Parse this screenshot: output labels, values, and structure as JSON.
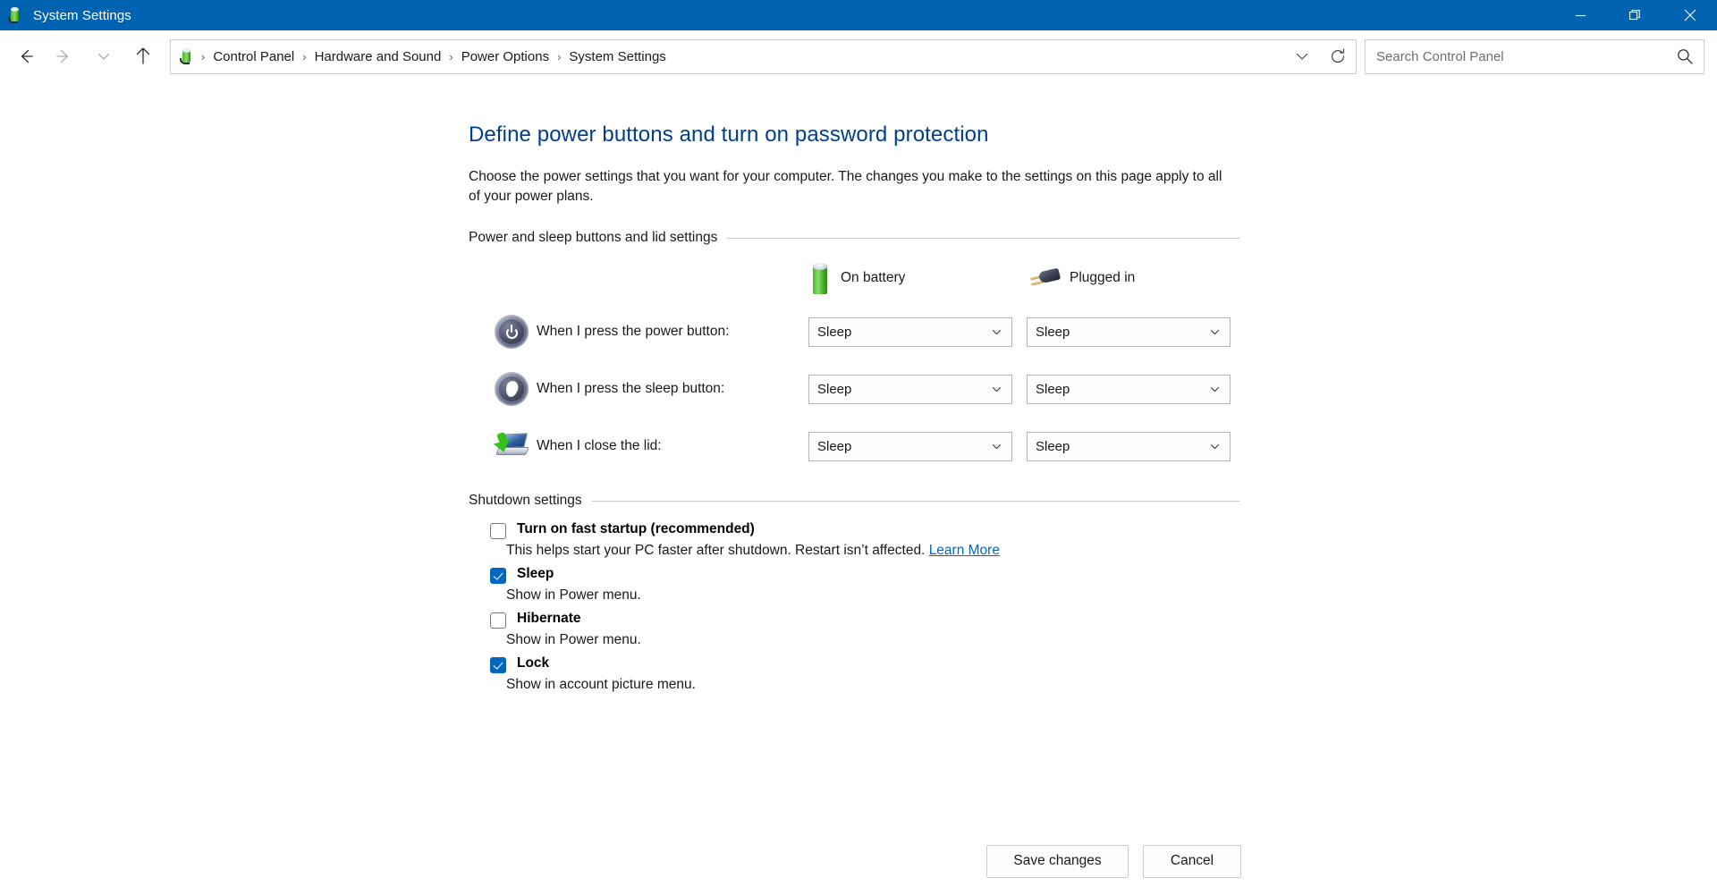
{
  "window": {
    "title": "System Settings",
    "app_icon": "power-battery-icon",
    "minimize": "minimize-icon",
    "maximize": "restore-icon",
    "close": "close-icon",
    "titlebar_color": "#0063b1"
  },
  "nav": {
    "back": "back-arrow-icon",
    "forward": "forward-arrow-icon",
    "recent": "chevron-down-icon",
    "up": "up-arrow-icon",
    "breadcrumb_icon": "power-battery-icon",
    "breadcrumbs": [
      "Control Panel",
      "Hardware and Sound",
      "Power Options",
      "System Settings"
    ],
    "separator": "›",
    "dropdown": "chevron-down-icon",
    "refresh": "refresh-icon"
  },
  "search": {
    "placeholder": "Search Control Panel",
    "value": "",
    "icon": "search-icon"
  },
  "main": {
    "title": "Define power buttons and turn on password protection",
    "title_color": "#003e92",
    "description": "Choose the power settings that you want for your computer. The changes you make to the settings on this page apply to all of your power plans.",
    "power_group": {
      "heading": "Power and sleep buttons and lid settings",
      "columns": [
        {
          "label": "On battery",
          "icon": "battery-icon"
        },
        {
          "label": "Plugged in",
          "icon": "power-plug-icon"
        }
      ],
      "rows": [
        {
          "icon": "power-button-icon",
          "label": "When I press the power button:",
          "on_battery": "Sleep",
          "plugged_in": "Sleep"
        },
        {
          "icon": "sleep-button-icon",
          "label": "When I press the sleep button:",
          "on_battery": "Sleep",
          "plugged_in": "Sleep"
        },
        {
          "icon": "laptop-lid-icon",
          "label": "When I close the lid:",
          "on_battery": "Sleep",
          "plugged_in": "Sleep"
        }
      ]
    },
    "shutdown_group": {
      "heading": "Shutdown settings",
      "items": [
        {
          "label": "Turn on fast startup (recommended)",
          "checked": false,
          "description": "This helps start your PC faster after shutdown. Restart isn’t affected.",
          "link": "Learn More"
        },
        {
          "label": "Sleep",
          "checked": true,
          "description": "Show in Power menu.",
          "link": ""
        },
        {
          "label": "Hibernate",
          "checked": false,
          "description": "Show in Power menu.",
          "link": ""
        },
        {
          "label": "Lock",
          "checked": true,
          "description": "Show in account picture menu.",
          "link": ""
        }
      ]
    }
  },
  "footer": {
    "save_label": "Save changes",
    "cancel_label": "Cancel"
  },
  "colors": {
    "accent": "#0067c0",
    "titlebar": "#0063b1",
    "link": "#0066cc",
    "heading": "#003e92"
  }
}
